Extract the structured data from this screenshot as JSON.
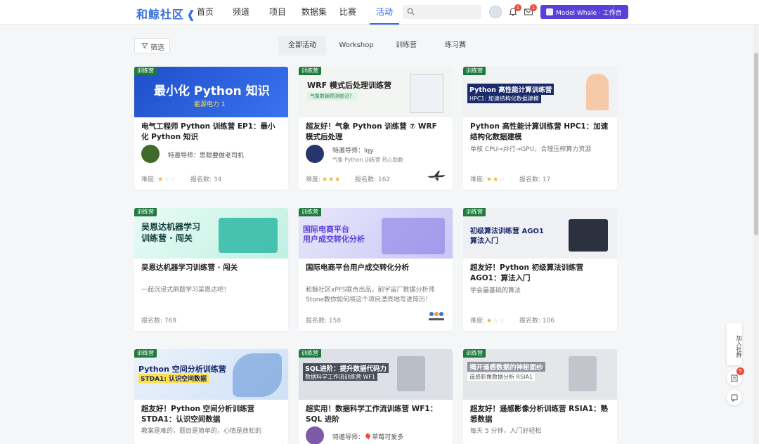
{
  "header": {
    "logo": "和鲸社区",
    "nav": [
      "首页",
      "频道",
      "项目",
      "数据集",
      "比赛",
      "活动"
    ],
    "active_nav": "活动",
    "search_placeholder": "",
    "notification_count": "1",
    "message_count": "1",
    "workspace_brand": "Model Whale",
    "workspace_label": "Model Whale · 工作台"
  },
  "filter": {
    "label": "筛选"
  },
  "tabs": [
    "全部活动",
    "Workshop",
    "训练营",
    "练习赛"
  ],
  "active_tab": "全部活动",
  "labels": {
    "difficulty": "难度:",
    "signups": "报名数:"
  },
  "cards": [
    {
      "tag": "训练营",
      "banner_title": "最小化 Python 知识",
      "banner_sub": "能源电力 1",
      "title": "电气工程师 Python 训练营 EP1：最小化 Python 知识",
      "mentor": "特邀导师：思聪要做老司机",
      "difficulty": 1,
      "signups": "34"
    },
    {
      "tag": "训练营",
      "banner_title": "WRF 模式后处理训练营",
      "banner_sub": "气象数据预测前沿？",
      "title": "超友好！气象 Python 训练营 ⑦ WRF 模式后处理",
      "mentor": "特邀导师：lqy",
      "mentor_sub": "气象 Python 训练营 热心助教",
      "difficulty": 3,
      "signups": "162"
    },
    {
      "tag": "训练营",
      "banner_title": "Python 高性能计算训练营",
      "banner_sub": "HPC1: 加速结构化数据建模",
      "title": "Python 高性能计算训练营 HPC1：加速结构化数据建模",
      "desc": "单核 CPU→并行→GPU，合理压榨算力资源",
      "difficulty": 2,
      "signups": "17"
    },
    {
      "tag": "训练营",
      "banner_title": "吴恩达机器学习",
      "banner_sub": "训练营 · 闯关",
      "title": "吴恩达机器学习训练营 · 闯关",
      "desc": "一起沉浸式刷题学习吴恩达吧！",
      "signups": "769"
    },
    {
      "tag": "训练营",
      "banner_title": "国际电商平台",
      "banner_sub": "用户成交转化分析",
      "title": "国际电商平台用户成交转化分析",
      "desc": "和鲸社区xPFS联合出品，前宇宙厂数据分析师Stone教你如何将这个项目漂亮地写进简历！",
      "signups": "158"
    },
    {
      "tag": "训练营",
      "banner_title": "初级算法训练营 AGO1",
      "banner_sub": "算法入门",
      "title": "超友好！Python 初级算法训练营 AGO1：算法入门",
      "desc": "学会最基础的算法",
      "difficulty": 1,
      "signups": "106"
    },
    {
      "tag": "训练营",
      "banner_title": "Python 空间分析训练营",
      "banner_sub": "STDA1: 认识空间数据",
      "title": "超友好！Python 空间分析训练营 STDA1：认识空间数据",
      "desc": "教案是难的，题目是简单的，心情是放松的"
    },
    {
      "tag": "训练营",
      "banner_title": "SQL进阶：提升数据代码力",
      "banner_sub": "数据科学工作流训练营 WF1",
      "title": "超实用！数据科学工作流训练营 WF1：SQL 进阶",
      "mentor": "特邀导师：🎈草莓可爱多"
    },
    {
      "tag": "训练营",
      "banner_title": "揭开遥感数据的神秘面纱",
      "banner_sub": "遥感影像数据分析 RSIA1",
      "title": "超友好！遥感影像分析训练营 RSIA1：熟悉数据",
      "desc": "每天 5 分钟，入门好轻松"
    }
  ],
  "side": {
    "join_group": "加入社群",
    "badge": "5"
  },
  "colors": {
    "accent": "#2f66e7",
    "workspace_btn": "#5b3fd9",
    "tag_green": "#1f7a3d",
    "star": "#e7b12b"
  }
}
